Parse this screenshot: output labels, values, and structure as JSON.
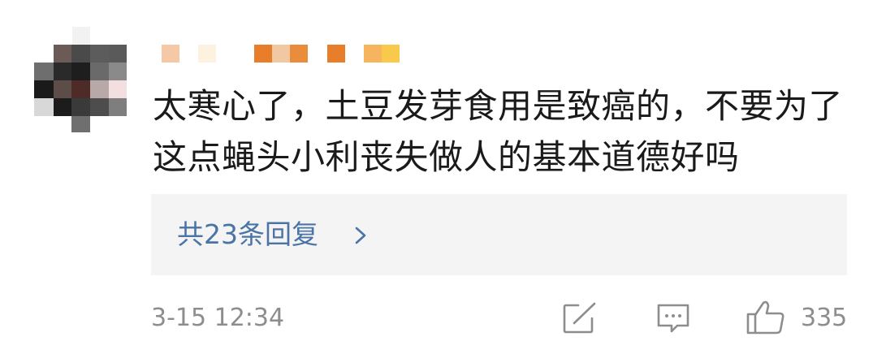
{
  "comment": {
    "author": {
      "name_obscured": true,
      "avatar_obscured": true
    },
    "text": "太寒心了，土豆发芽食用是致癌的，不要为了这点蝇头小利丧失做人的基本道德好吗",
    "replies": {
      "label": "共23条回复",
      "chevron_icon": "chevron-right-icon"
    },
    "timestamp": "3-15 12:34",
    "actions": {
      "share_icon": "share-icon",
      "comment_icon": "comment-icon",
      "like_icon": "thumbs-up-icon",
      "like_count": "335"
    }
  },
  "colors": {
    "text": "#1a1a1a",
    "link": "#4a73a6",
    "meta": "#8d8d8d",
    "reply_box_bg": "#f4f4f4",
    "username_blocks": [
      "#f5c9a5",
      "#fdf1e0",
      "#e87d2a",
      "#f2c8a3",
      "#e98c3c",
      "#f6b45e",
      "#f8c94a"
    ]
  }
}
